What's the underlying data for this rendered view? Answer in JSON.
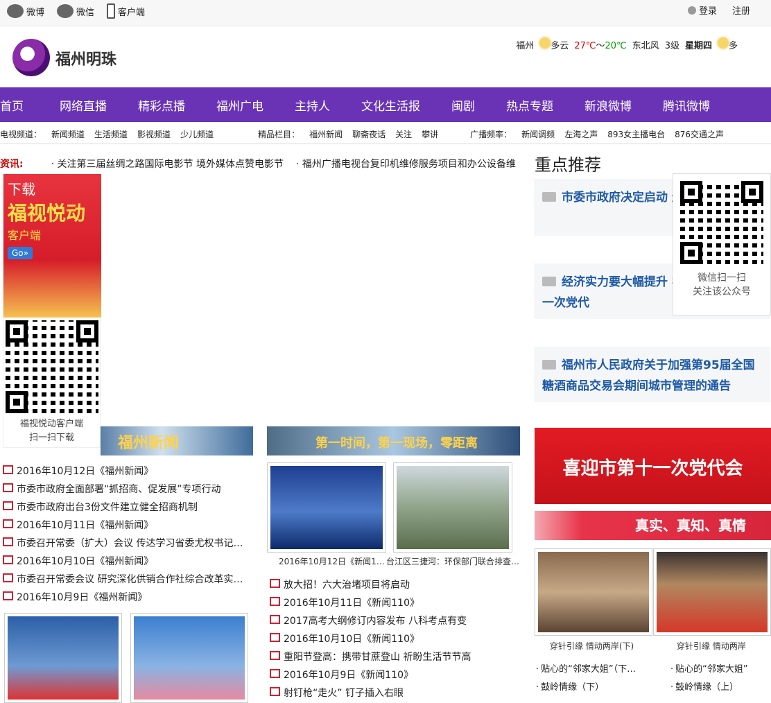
{
  "topbar": {
    "weibo": "微博",
    "weixin": "微信",
    "client": "客户端",
    "login": "登录",
    "register": "注册"
  },
  "header": {
    "site_name": "福州明珠",
    "weather": {
      "city": "福州",
      "cond": "多云",
      "temp_high": "27℃",
      "sep": "～",
      "temp_low": "20℃",
      "wind": "东北风",
      "level": "3级",
      "day": "星期四",
      "cond2": "多"
    }
  },
  "nav": [
    "首页",
    "网络直播",
    "精彩点播",
    "福州广电",
    "主持人",
    "文化生活报",
    "闽剧",
    "热点专题",
    "新浪微博",
    "腾讯微博"
  ],
  "subnav": {
    "tv_label": "电视频道：",
    "tv": [
      "新闻频道",
      "生活频道",
      "影视频道",
      "少儿频道"
    ],
    "prog_label": "精品栏目：",
    "prog": [
      "福州新闻",
      "聊斋夜话",
      "关注",
      "攀讲"
    ],
    "radio_label": "广播频率：",
    "radio": [
      "新闻调频",
      "左海之声",
      "893女主播电台",
      "876交通之声"
    ]
  },
  "news": {
    "label": "资讯:",
    "items": [
      "· 关注第三届丝绸之路国际电影节 境外媒体点赞电影节",
      "· 福州广播电视台复印机维修服务项目和办公设备维"
    ]
  },
  "ad": {
    "t1": "下载",
    "t2": "福视悦动",
    "t3": "客户端",
    "go": "Go»",
    "cap1": "福视悦动客户端",
    "cap2": "扫一扫下载"
  },
  "rec": {
    "title": "重点推荐",
    "items": [
      "市委市政府决定启动 边区域综合治理",
      "经济实力要大幅提升 学习贯彻市第十一次党代",
      "福州市人民政府关于加强第95届全国糖酒商品交易会期间城市管理的通告"
    ]
  },
  "qrpop": {
    "cap1": "微信扫一扫",
    "cap2": "关注该公众号"
  },
  "col1": {
    "band": "福州新闻",
    "list": [
      "2016年10月12日《福州新闻》",
      "市委市政府全面部署“抓招商、促发展”专项行动",
      "市委市政府出台3份文件建立健全招商机制",
      "2016年10月11日《福州新闻》",
      "市委召开常委（扩大）会议 传达学习省委尤权书记…",
      "2016年10月10日《福州新闻》",
      "市委召开常委会议 研究深化供销合作社综合改革实…",
      "2016年10月9日《福州新闻》"
    ]
  },
  "col2": {
    "band": "第一时间，第一现场，零距离",
    "caps": [
      "2016年10月12日《新闻1…",
      "台江区三捷河：环保部门联合排查…"
    ],
    "list": [
      "放大招！六大治堵项目将启动",
      "2016年10月11日《新闻110》",
      "2017高考大纲修订内容发布 八科考点有变",
      "2016年10月10日《新闻110》",
      "重阳节登高：携带甘蔗登山 祈盼生活节节高",
      "2016年10月9日《新闻110》",
      "射钉枪“走火” 钉子插入右眼"
    ]
  },
  "col3": {
    "party": "喜迎市第十一次党代会",
    "truth": "真实、真知、真情",
    "caps": [
      "穿针引缘 情动两岸(下)",
      "穿针引缘 情动两岸"
    ],
    "list_a": [
      "贴心的“邻家大姐”（下…",
      "鼓岭情缘（下）"
    ],
    "list_b": [
      "贴心的“邻家大姐”",
      "鼓岭情缘（上）"
    ]
  }
}
